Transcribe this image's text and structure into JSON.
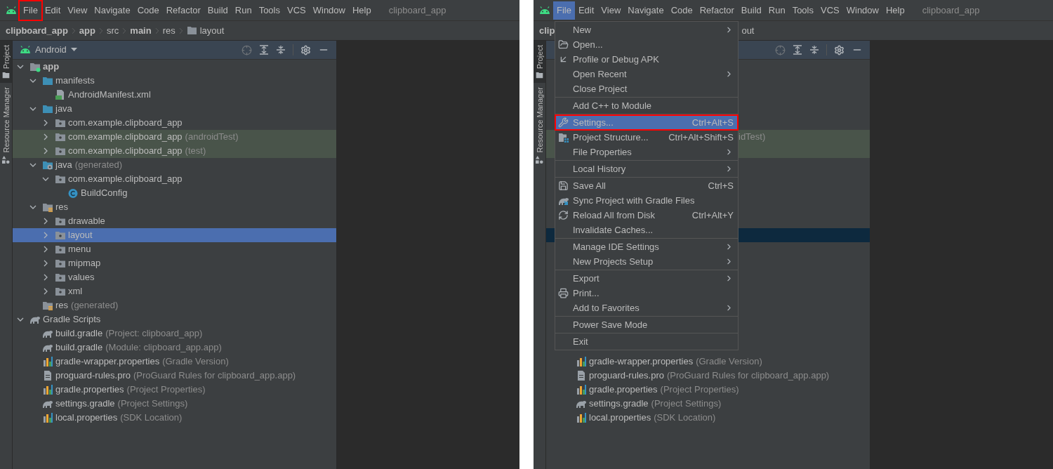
{
  "screens": [
    {
      "menu_bar": {
        "items": [
          {
            "label": "File",
            "selected": false,
            "outlined": true
          },
          {
            "label": "Edit",
            "selected": false,
            "outlined": false
          },
          {
            "label": "View",
            "selected": false,
            "outlined": false
          },
          {
            "label": "Navigate",
            "selected": false,
            "outlined": false
          },
          {
            "label": "Code",
            "selected": false,
            "outlined": false
          },
          {
            "label": "Refactor",
            "selected": false,
            "outlined": false
          },
          {
            "label": "Build",
            "selected": false,
            "outlined": false
          },
          {
            "label": "Run",
            "selected": false,
            "outlined": false
          },
          {
            "label": "Tools",
            "selected": false,
            "outlined": false
          },
          {
            "label": "VCS",
            "selected": false,
            "outlined": false
          },
          {
            "label": "Window",
            "selected": false,
            "outlined": false
          },
          {
            "label": "Help",
            "selected": false,
            "outlined": false
          }
        ],
        "project_name": "clipboard_app"
      },
      "breadcrumbs": [
        {
          "label": "clipboard_app",
          "bold": true,
          "kind": "crumb"
        },
        {
          "label": "app",
          "bold": true,
          "kind": "crumb"
        },
        {
          "label": "src",
          "bold": false,
          "kind": "crumb"
        },
        {
          "label": "main",
          "bold": true,
          "kind": "crumb"
        },
        {
          "label": "res",
          "bold": false,
          "kind": "crumb"
        },
        {
          "label": "layout",
          "bold": false,
          "kind": "folder"
        }
      ],
      "side_tabs": [
        {
          "label": "Project",
          "selected": true
        },
        {
          "label": "Resource Manager",
          "selected": false
        }
      ],
      "project_panel": {
        "view": "Android",
        "focused": true,
        "tree": [
          {
            "label": "app",
            "bold": true,
            "kind": "module",
            "expanded": true,
            "selected": false,
            "test_scope": false,
            "children": [
              {
                "label": "manifests",
                "kind": "folder-blue",
                "expanded": true,
                "selected": false,
                "test_scope": false,
                "children": [
                  {
                    "label": "AndroidManifest.xml",
                    "kind": "manifest",
                    "selected": false,
                    "test_scope": false
                  }
                ]
              },
              {
                "label": "java",
                "kind": "folder-blue",
                "expanded": true,
                "selected": false,
                "test_scope": false,
                "children": [
                  {
                    "label": "com.example.clipboard_app",
                    "kind": "package",
                    "expanded": false,
                    "selected": false,
                    "test_scope": false
                  },
                  {
                    "label": "com.example.clipboard_app",
                    "hint": "(androidTest)",
                    "kind": "package",
                    "expanded": false,
                    "selected": false,
                    "test_scope": true
                  },
                  {
                    "label": "com.example.clipboard_app",
                    "hint": "(test)",
                    "kind": "package",
                    "expanded": false,
                    "selected": false,
                    "test_scope": true
                  }
                ]
              },
              {
                "label": "java",
                "hint": "(generated)",
                "kind": "java-generated",
                "expanded": true,
                "selected": false,
                "test_scope": false,
                "children": [
                  {
                    "label": "com.example.clipboard_app",
                    "kind": "package",
                    "expanded": true,
                    "selected": false,
                    "test_scope": false,
                    "children": [
                      {
                        "label": "BuildConfig",
                        "kind": "class",
                        "selected": false,
                        "test_scope": false
                      }
                    ]
                  }
                ]
              },
              {
                "label": "res",
                "kind": "res-folder",
                "expanded": true,
                "selected": false,
                "test_scope": false,
                "children": [
                  {
                    "label": "drawable",
                    "kind": "package",
                    "expanded": false,
                    "selected": false,
                    "test_scope": false
                  },
                  {
                    "label": "layout",
                    "kind": "package",
                    "expanded": false,
                    "selected": true,
                    "test_scope": false
                  },
                  {
                    "label": "menu",
                    "kind": "package",
                    "expanded": false,
                    "selected": false,
                    "test_scope": false
                  },
                  {
                    "label": "mipmap",
                    "kind": "package",
                    "expanded": false,
                    "selected": false,
                    "test_scope": false
                  },
                  {
                    "label": "values",
                    "kind": "package",
                    "expanded": false,
                    "selected": false,
                    "test_scope": false
                  },
                  {
                    "label": "xml",
                    "kind": "package",
                    "expanded": false,
                    "selected": false,
                    "test_scope": false
                  }
                ]
              },
              {
                "label": "res",
                "hint": "(generated)",
                "kind": "res-folder",
                "selected": false,
                "test_scope": false
              }
            ]
          },
          {
            "label": "Gradle Scripts",
            "kind": "gradle",
            "expanded": true,
            "selected": false,
            "test_scope": false,
            "children": [
              {
                "label": "build.gradle",
                "hint": "(Project: clipboard_app)",
                "kind": "gradle",
                "selected": false,
                "test_scope": false
              },
              {
                "label": "build.gradle",
                "hint": "(Module: clipboard_app.app)",
                "kind": "gradle",
                "selected": false,
                "test_scope": false
              },
              {
                "label": "gradle-wrapper.properties",
                "hint": "(Gradle Version)",
                "kind": "properties",
                "selected": false,
                "test_scope": false
              },
              {
                "label": "proguard-rules.pro",
                "hint": "(ProGuard Rules for clipboard_app.app)",
                "kind": "text-file",
                "selected": false,
                "test_scope": false
              },
              {
                "label": "gradle.properties",
                "hint": "(Project Properties)",
                "kind": "properties",
                "selected": false,
                "test_scope": false
              },
              {
                "label": "settings.gradle",
                "hint": "(Project Settings)",
                "kind": "gradle",
                "selected": false,
                "test_scope": false
              },
              {
                "label": "local.properties",
                "hint": "(SDK Location)",
                "kind": "properties",
                "selected": false,
                "test_scope": false
              }
            ]
          }
        ]
      }
    },
    {
      "menu_bar": {
        "items": [
          {
            "label": "File",
            "selected": true,
            "outlined": false
          },
          {
            "label": "Edit",
            "selected": false,
            "outlined": false
          },
          {
            "label": "View",
            "selected": false,
            "outlined": false
          },
          {
            "label": "Navigate",
            "selected": false,
            "outlined": false
          },
          {
            "label": "Code",
            "selected": false,
            "outlined": false
          },
          {
            "label": "Refactor",
            "selected": false,
            "outlined": false
          },
          {
            "label": "Build",
            "selected": false,
            "outlined": false
          },
          {
            "label": "Run",
            "selected": false,
            "outlined": false
          },
          {
            "label": "Tools",
            "selected": false,
            "outlined": false
          },
          {
            "label": "VCS",
            "selected": false,
            "outlined": false
          },
          {
            "label": "Window",
            "selected": false,
            "outlined": false
          },
          {
            "label": "Help",
            "selected": false,
            "outlined": false
          }
        ],
        "project_name": "clipboard_app"
      },
      "breadcrumbs": [
        {
          "label": "clip",
          "bold": true,
          "kind": "crumb"
        },
        {
          "label": "out",
          "bold": false,
          "kind": "tail"
        }
      ],
      "side_tabs": [
        {
          "label": "Project",
          "selected": true
        },
        {
          "label": "Resource Manager",
          "selected": false
        }
      ],
      "project_panel": {
        "focused": false,
        "rows": [
          {
            "kind": "covered",
            "selected": false,
            "test_scope": false
          },
          {
            "kind": "covered",
            "selected": false,
            "test_scope": false
          },
          {
            "kind": "covered",
            "selected": false,
            "test_scope": false
          },
          {
            "kind": "covered",
            "selected": false,
            "test_scope": false
          },
          {
            "kind": "covered",
            "selected": false,
            "test_scope": false
          },
          {
            "kind": "covered",
            "tail": "idTest)",
            "selected": false,
            "test_scope": true
          },
          {
            "kind": "covered",
            "selected": false,
            "test_scope": true
          },
          {
            "kind": "covered",
            "selected": false,
            "test_scope": false
          },
          {
            "kind": "covered",
            "selected": false,
            "test_scope": false
          },
          {
            "kind": "covered",
            "selected": false,
            "test_scope": false
          },
          {
            "kind": "covered",
            "selected": false,
            "test_scope": false
          },
          {
            "kind": "covered",
            "selected": false,
            "test_scope": false
          },
          {
            "kind": "covered",
            "selected": true,
            "test_scope": false
          },
          {
            "kind": "covered",
            "selected": false,
            "test_scope": false
          },
          {
            "kind": "covered",
            "selected": false,
            "test_scope": false
          },
          {
            "kind": "covered",
            "selected": false,
            "test_scope": false
          },
          {
            "kind": "covered",
            "selected": false,
            "test_scope": false
          },
          {
            "kind": "covered",
            "selected": false,
            "test_scope": false
          },
          {
            "kind": "covered",
            "selected": false,
            "test_scope": false
          },
          {
            "kind": "covered",
            "selected": false,
            "test_scope": false
          },
          {
            "kind": "covered",
            "selected": false,
            "test_scope": false
          },
          {
            "kind": "properties",
            "label": "gradle-wrapper.properties",
            "hint": "(Gradle Version)",
            "selected": false,
            "test_scope": false
          },
          {
            "kind": "text-file",
            "label": "proguard-rules.pro",
            "hint": "(ProGuard Rules for clipboard_app.app)",
            "selected": false,
            "test_scope": false
          },
          {
            "kind": "properties",
            "label": "gradle.properties",
            "hint": "(Project Properties)",
            "selected": false,
            "test_scope": false
          },
          {
            "kind": "gradle",
            "label": "settings.gradle",
            "hint": "(Project Settings)",
            "selected": false,
            "test_scope": false
          },
          {
            "kind": "properties",
            "label": "local.properties",
            "hint": "(SDK Location)",
            "selected": false,
            "test_scope": false
          }
        ]
      },
      "file_menu": [
        {
          "kind": "plain",
          "label": "New",
          "submenu": true,
          "selected": false,
          "outlined": false
        },
        {
          "kind": "open",
          "label": "Open...",
          "submenu": false,
          "selected": false,
          "outlined": false
        },
        {
          "kind": "profile",
          "label": "Profile or Debug APK",
          "submenu": false,
          "selected": false,
          "outlined": false
        },
        {
          "kind": "plain",
          "label": "Open Recent",
          "submenu": true,
          "selected": false,
          "outlined": false
        },
        {
          "kind": "plain",
          "label": "Close Project",
          "submenu": false,
          "selected": false,
          "outlined": false
        },
        {
          "kind": "separator"
        },
        {
          "kind": "plain",
          "label": "Add C++ to Module",
          "submenu": false,
          "selected": false,
          "outlined": false
        },
        {
          "kind": "separator"
        },
        {
          "kind": "wrench",
          "label": "Settings...",
          "shortcut": "Ctrl+Alt+S",
          "submenu": false,
          "selected": true,
          "outlined": true
        },
        {
          "kind": "structure",
          "label": "Project Structure...",
          "shortcut": "Ctrl+Alt+Shift+S",
          "submenu": false,
          "selected": false,
          "outlined": false
        },
        {
          "kind": "plain",
          "label": "File Properties",
          "submenu": true,
          "selected": false,
          "outlined": false
        },
        {
          "kind": "separator"
        },
        {
          "kind": "plain",
          "label": "Local History",
          "submenu": true,
          "selected": false,
          "outlined": false
        },
        {
          "kind": "separator"
        },
        {
          "kind": "save",
          "label": "Save All",
          "shortcut": "Ctrl+S",
          "submenu": false,
          "selected": false,
          "outlined": false
        },
        {
          "kind": "sync",
          "label": "Sync Project with Gradle Files",
          "submenu": false,
          "selected": false,
          "outlined": false
        },
        {
          "kind": "reload",
          "label": "Reload All from Disk",
          "shortcut": "Ctrl+Alt+Y",
          "submenu": false,
          "selected": false,
          "outlined": false
        },
        {
          "kind": "plain",
          "label": "Invalidate Caches...",
          "submenu": false,
          "selected": false,
          "outlined": false
        },
        {
          "kind": "separator"
        },
        {
          "kind": "plain",
          "label": "Manage IDE Settings",
          "submenu": true,
          "selected": false,
          "outlined": false
        },
        {
          "kind": "plain",
          "label": "New Projects Setup",
          "submenu": true,
          "selected": false,
          "outlined": false
        },
        {
          "kind": "separator"
        },
        {
          "kind": "plain",
          "label": "Export",
          "submenu": true,
          "selected": false,
          "outlined": false
        },
        {
          "kind": "print",
          "label": "Print...",
          "submenu": false,
          "selected": false,
          "outlined": false
        },
        {
          "kind": "plain",
          "label": "Add to Favorites",
          "submenu": true,
          "selected": false,
          "outlined": false
        },
        {
          "kind": "separator"
        },
        {
          "kind": "plain",
          "label": "Power Save Mode",
          "submenu": false,
          "selected": false,
          "outlined": false
        },
        {
          "kind": "separator"
        },
        {
          "kind": "plain",
          "label": "Exit",
          "submenu": false,
          "selected": false,
          "outlined": false
        }
      ]
    }
  ]
}
